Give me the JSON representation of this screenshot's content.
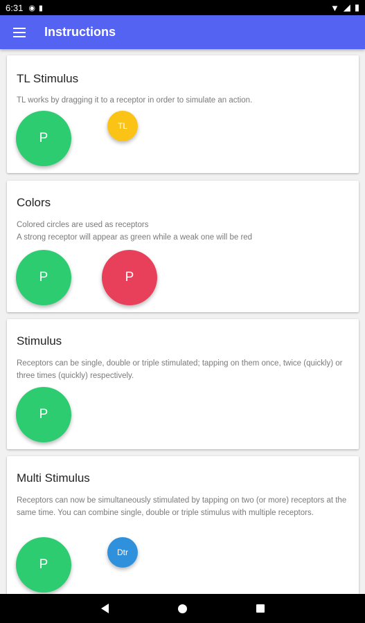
{
  "status_bar": {
    "time": "6:31"
  },
  "app_bar": {
    "title": "Instructions",
    "menu_icon": "hamburger-menu-icon"
  },
  "colors": {
    "app_bar": "#5463f2",
    "green": "#2ecc71",
    "red": "#e8405a",
    "yellow": "#fcc317",
    "blue": "#2f91db"
  },
  "cards": [
    {
      "title": "TL Stimulus",
      "description": "TL works by dragging it to a receptor in order to simulate an action.",
      "receptors": [
        "P"
      ],
      "stimulus": "TL"
    },
    {
      "title": "Colors",
      "description_lines": [
        "Colored circles are used as receptors",
        "A strong receptor will appear as green while a weak one will be red"
      ],
      "receptors": [
        "P",
        "P"
      ]
    },
    {
      "title": "Stimulus",
      "description": "Receptors can be single, double or triple stimulated; tapping on them once, twice (quickly) or three times (quickly) respectively.",
      "receptors": [
        "P"
      ]
    },
    {
      "title": "Multi Stimulus",
      "description": "Receptors can now be simultaneously stimulated by tapping on two (or more) receptors at the same time. You can combine single, double or triple stimulus with multiple receptors.",
      "receptors": [
        "P"
      ],
      "stimulus": "Dtr"
    }
  ]
}
